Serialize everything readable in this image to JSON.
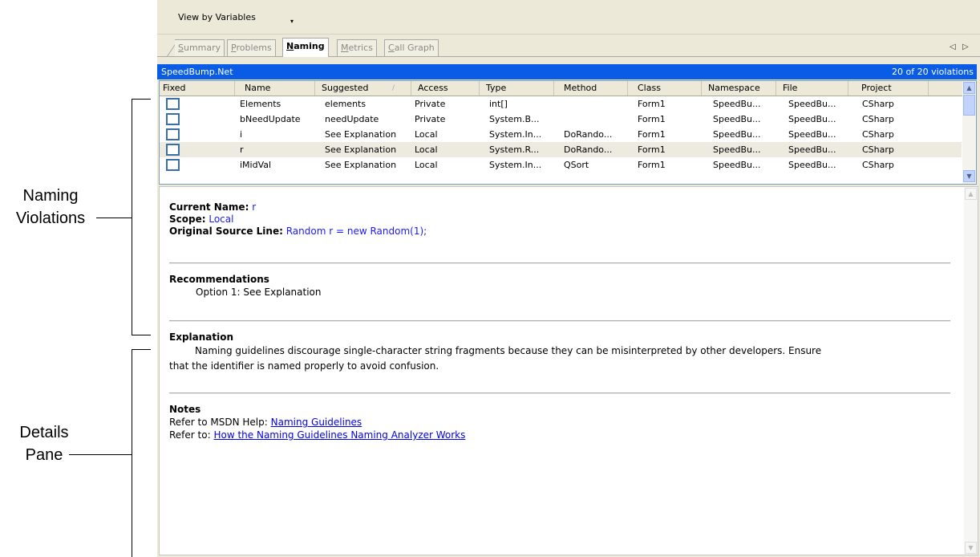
{
  "annotations": {
    "naming_violations": [
      "Naming",
      "Violations"
    ],
    "details_pane": [
      "Details",
      "Pane"
    ]
  },
  "toolbar": {
    "view_by": "View by Variables",
    "dropdown_glyph": "▾"
  },
  "tabs": [
    {
      "label_u": "S",
      "label_rest": "ummary"
    },
    {
      "label_u": "P",
      "label_rest": "roblems"
    },
    {
      "label_u": "N",
      "label_rest": "aming"
    },
    {
      "label_u": "M",
      "label_rest": "etrics"
    },
    {
      "label_u": "C",
      "label_rest": "all Graph"
    }
  ],
  "tab_scroll": {
    "left": "◁",
    "right": "▷"
  },
  "panel": {
    "project_name": "SpeedBump.Net",
    "violation_count": "20 of 20 violations"
  },
  "grid": {
    "columns": [
      "Fixed",
      "Name",
      "Suggested",
      "Access",
      "Type",
      "Method",
      "Class",
      "Namespace",
      "File",
      "Project"
    ],
    "sort_glyph": "/",
    "rows": [
      [
        "",
        "Elements",
        "elements",
        "Private",
        "int[]",
        "",
        "Form1",
        "SpeedBu...",
        "SpeedBu...",
        "CSharp"
      ],
      [
        "",
        "bNeedUpdate",
        "needUpdate",
        "Private",
        "System.B...",
        "",
        "Form1",
        "SpeedBu...",
        "SpeedBu...",
        "CSharp"
      ],
      [
        "",
        "i",
        "See Explanation",
        "Local",
        "System.In...",
        "DoRando...",
        "Form1",
        "SpeedBu...",
        "SpeedBu...",
        "CSharp"
      ],
      [
        "",
        "r",
        "See Explanation",
        "Local",
        "System.R...",
        "DoRando...",
        "Form1",
        "SpeedBu...",
        "SpeedBu...",
        "CSharp"
      ],
      [
        "",
        "iMidVal",
        "See Explanation",
        "Local",
        "System.In...",
        "QSort",
        "Form1",
        "SpeedBu...",
        "SpeedBu...",
        "CSharp"
      ]
    ],
    "selected_row": 3
  },
  "details": {
    "current_name_label": "Current Name:",
    "current_name_value": "r",
    "scope_label": "Scope:",
    "scope_value": "Local",
    "source_label": "Original Source Line:",
    "source_value": "Random r = new Random(1);",
    "recommendations_heading": "Recommendations",
    "recommendation_1": "Option 1: See Explanation",
    "explanation_heading": "Explanation",
    "explanation_line1": "Naming guidelines discourage single-character string fragments because they can be misinterpreted by other developers. Ensure",
    "explanation_line2": "that the identifier is named properly to avoid confusion.",
    "notes_heading": "Notes",
    "note1_prefix": "Refer to MSDN Help:",
    "note1_link": "Naming Guidelines",
    "note2_prefix": "Refer to:",
    "note2_link": "How the Naming Guidelines Naming Analyzer Works"
  }
}
